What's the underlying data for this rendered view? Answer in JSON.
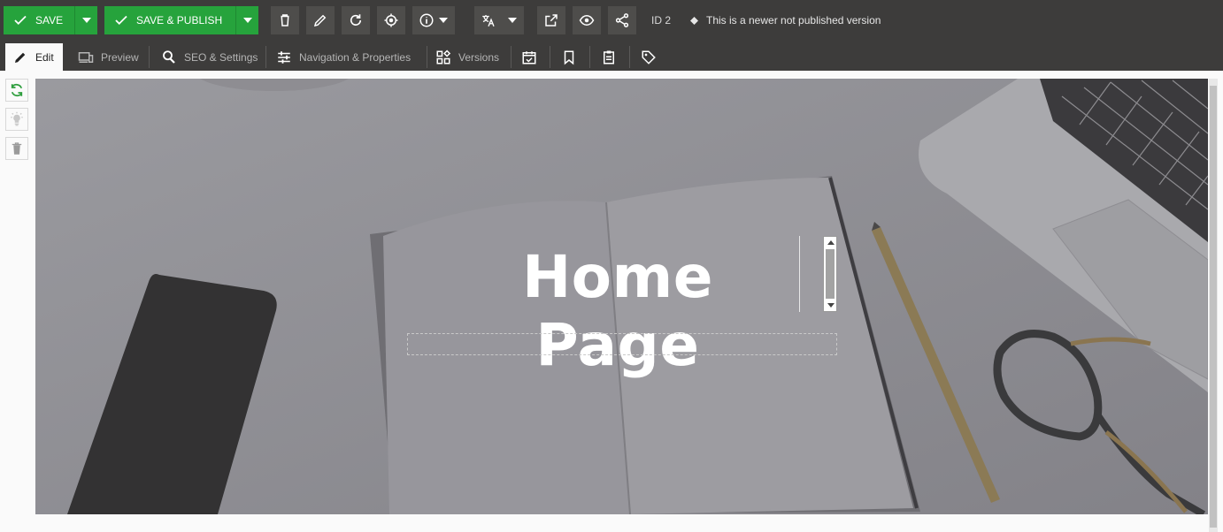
{
  "toolbar": {
    "save_label": "SAVE",
    "save_publish_label": "SAVE & PUBLISH",
    "id_label": "ID 2",
    "version_note": "This is a newer not published version"
  },
  "tabs": [
    {
      "label": "Edit",
      "icon": "pencil-icon",
      "active": true
    },
    {
      "label": "Preview",
      "icon": "devices-icon",
      "active": false
    },
    {
      "label": "SEO & Settings",
      "icon": "search-settings-icon",
      "active": false
    },
    {
      "label": "Navigation & Properties",
      "icon": "sliders-icon",
      "active": false
    },
    {
      "label": "Versions",
      "icon": "versions-icon",
      "active": false
    }
  ],
  "icon_tabs": [
    "calendar-check-icon",
    "bookmark-icon",
    "clipboard-icon",
    "tag-icon"
  ],
  "side_tools": [
    "refresh-icon",
    "lightbulb-icon",
    "trash-icon"
  ],
  "hero": {
    "title": "Home Page",
    "subtitle": ""
  },
  "colors": {
    "toolbar_bg": "#3d3c3b",
    "tool_bg": "#4e4d4b",
    "save_green": "#26a33c",
    "hero_overlay": "#8a898f"
  }
}
